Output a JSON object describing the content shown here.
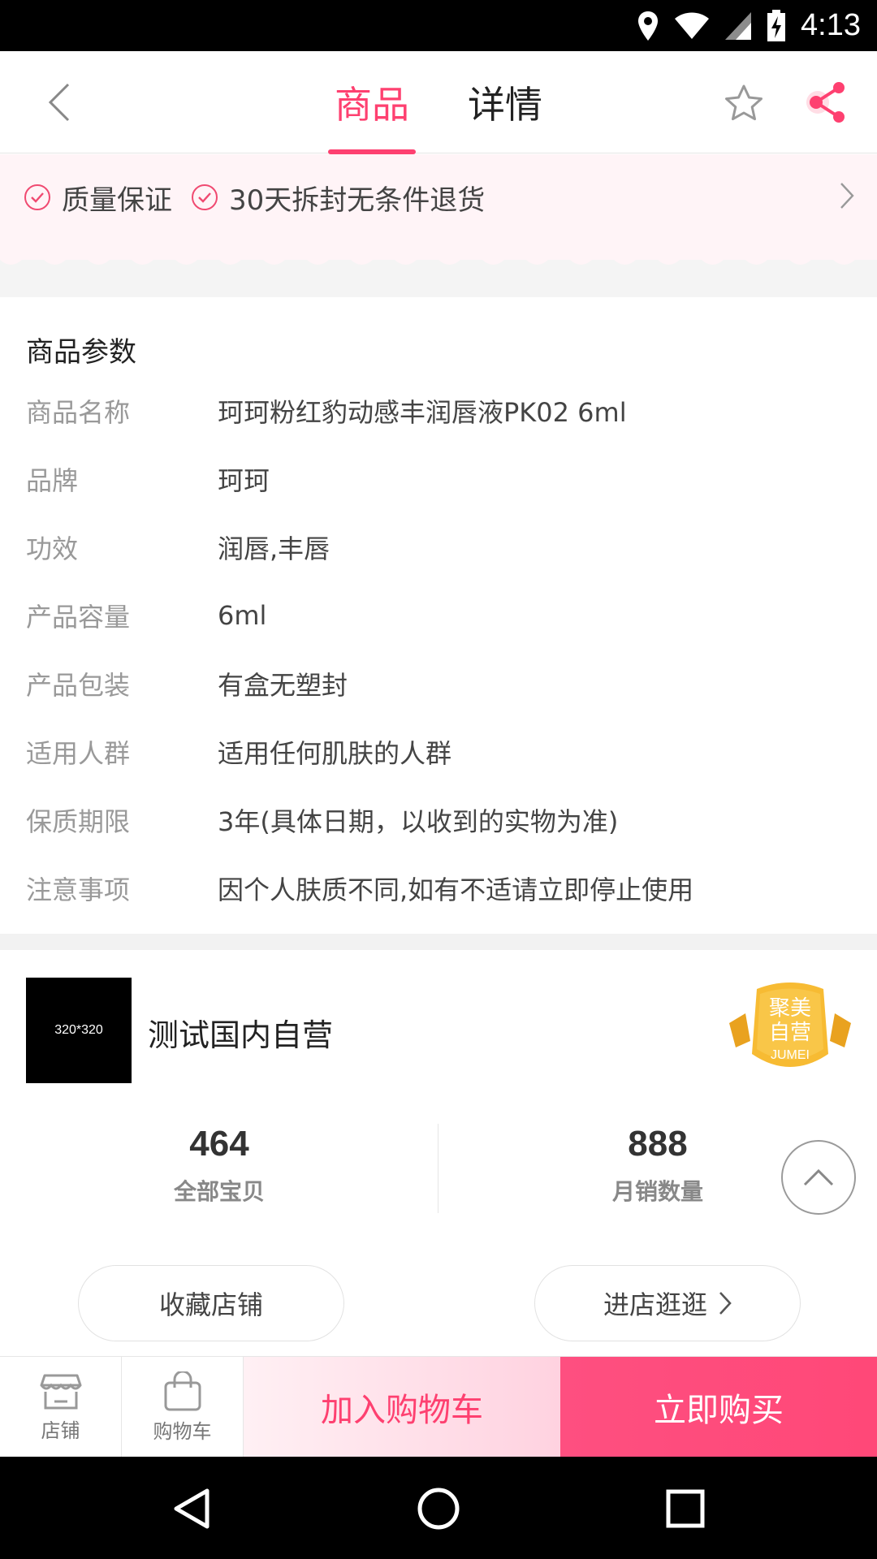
{
  "status_bar": {
    "time": "4:13"
  },
  "top_nav": {
    "tabs": [
      {
        "label": "商品",
        "active": true
      },
      {
        "label": "详情",
        "active": false
      }
    ]
  },
  "guarantee": {
    "items": [
      "质量保证",
      "30天拆封无条件退货"
    ]
  },
  "params": {
    "title": "商品参数",
    "rows": [
      {
        "key": "商品名称",
        "value": "珂珂粉红豹动感丰润唇液PK02 6ml"
      },
      {
        "key": "品牌",
        "value": "珂珂"
      },
      {
        "key": "功效",
        "value": "润唇,丰唇"
      },
      {
        "key": "产品容量",
        "value": "6ml"
      },
      {
        "key": "产品包装",
        "value": "有盒无塑封"
      },
      {
        "key": "适用人群",
        "value": "适用任何肌肤的人群"
      },
      {
        "key": "保质期限",
        "value": "3年(具体日期，以收到的实物为准)"
      },
      {
        "key": "注意事项",
        "value": "因个人肤质不同,如有不适请立即停止使用"
      }
    ]
  },
  "shop": {
    "logo_text": "320*320",
    "name": "测试国内自营",
    "badge": {
      "line1": "聚美",
      "line2": "自营",
      "line3": "JUMEI"
    },
    "stats": [
      {
        "value": "464",
        "label": "全部宝贝"
      },
      {
        "value": "888",
        "label": "月销数量"
      }
    ],
    "fav_label": "收藏店铺",
    "enter_label": "进店逛逛"
  },
  "bottom_bar": {
    "store_label": "店铺",
    "cart_label": "购物车",
    "add_cart_label": "加入购物车",
    "buy_now_label": "立即购买"
  },
  "colors": {
    "accent": "#fe4070",
    "badge_gold": "#f5b52e"
  }
}
